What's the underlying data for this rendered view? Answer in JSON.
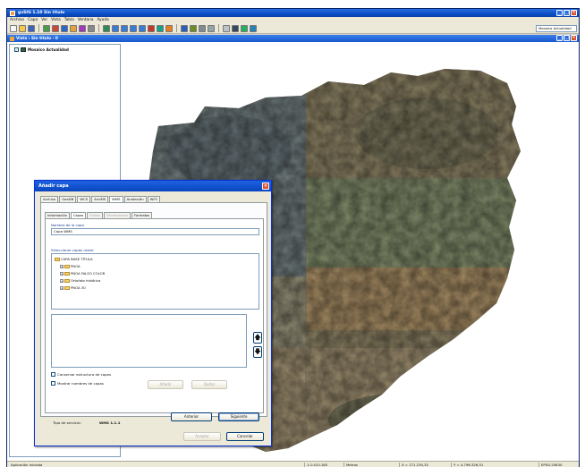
{
  "app": {
    "title": "gvSIG 1.10 Sin titulo",
    "menu": [
      "Archivo",
      "Capa",
      "Ver",
      "Vista",
      "Tabla",
      "Ventana",
      "Ayuda"
    ],
    "scale_combo": "Mosaico Actualidad"
  },
  "view": {
    "title": "Vista : Sin titulo - 0",
    "layer_name": "Mosaico Actualidad"
  },
  "dialog": {
    "title": "Añadir capa",
    "tabs": [
      "Archivo",
      "GeoDB",
      "WCS",
      "ArcIMS",
      "WMS",
      "Anotación",
      "WFS"
    ],
    "active_tab": "WMS",
    "subtabs": [
      "Información",
      "Capas",
      "Estilos",
      "Dimensiones",
      "Formatos"
    ],
    "layer_name_label": "Nombre de la capa",
    "layer_name_value": "Capa WMS",
    "select_label": "Seleccionar capas raster",
    "tree_root": "CAPA BASE TÍTULA",
    "tree_children": [
      "PNOA",
      "PNOA FALSO COLOR",
      "Ortofoto histórica",
      "PNOA 30"
    ],
    "keep_structure": "Conservar estructura de capas",
    "show_names": "Mostrar nombres de capas",
    "add_label": "Añadir",
    "remove_label": "Quitar",
    "service_type_label": "Tipo de servicio:",
    "service_type_value": "WMS 1.1.1",
    "prev_button": "Anterior",
    "next_button": "Siguiente",
    "accept_button": "Aceptar",
    "cancel_button": "Cancelar",
    "up_arrow": "🡅",
    "down_arrow": "🡇"
  },
  "status": {
    "left": "Aplicación iniciada",
    "scale": "1:1:410.165",
    "units": "Metros",
    "x": "X = 171.230,32",
    "y": "Y = 4.796.326,51",
    "epsg": "EPSG:25830"
  }
}
